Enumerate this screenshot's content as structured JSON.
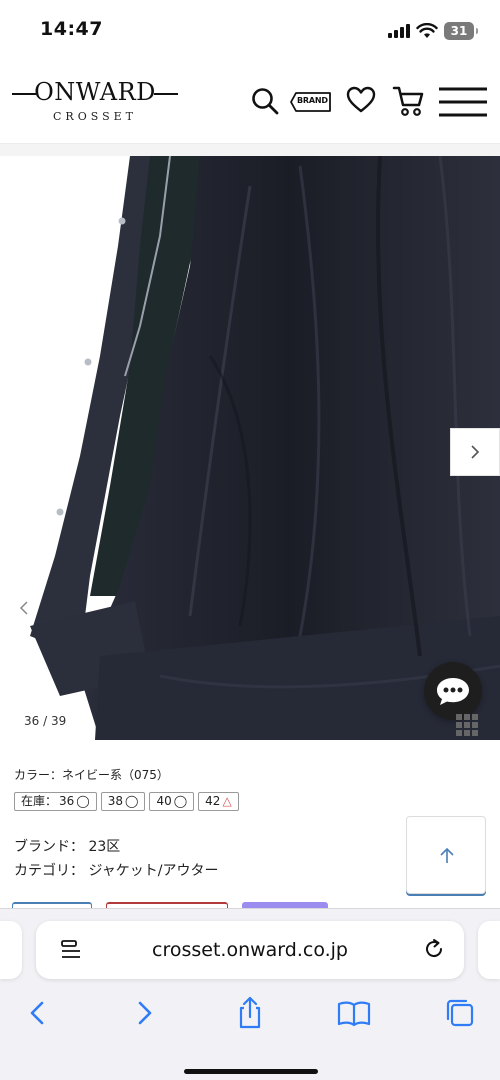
{
  "status_bar": {
    "time": "14:47",
    "battery": "31"
  },
  "header": {
    "logo_main": "ONWARD",
    "logo_sub": "CROSSET",
    "brand_tag": "BRAND"
  },
  "carousel": {
    "counter": "36 / 39"
  },
  "product": {
    "color_line": "カラー：ネイビー系（075）",
    "stock_label": "在庫：",
    "sizes": [
      {
        "size": "36",
        "mark": "◯"
      },
      {
        "size": "38",
        "mark": "◯"
      },
      {
        "size": "40",
        "mark": "◯"
      },
      {
        "size": "42",
        "mark": "△"
      }
    ],
    "brand_line": "ブランド： 23区",
    "category_line": "カテゴリ： ジャケット/アウター"
  },
  "colors": {
    "accent_blue": "#4a7fb5",
    "warn_red": "#d9534f",
    "stub_purple": "#9b8cf0",
    "stub_red": "#b13a3a"
  },
  "browser": {
    "url": "crosset.onward.co.jp"
  }
}
